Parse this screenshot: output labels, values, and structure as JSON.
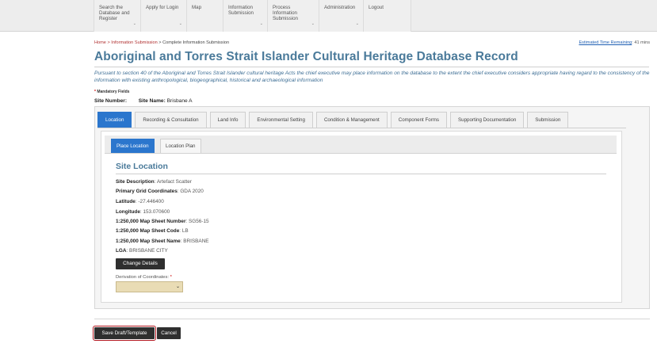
{
  "nav": {
    "items": [
      {
        "line1": "Search the",
        "line2": "Database and",
        "line3": "Register",
        "chevron": "⌄"
      },
      {
        "line1": "Apply for Login",
        "line2": "",
        "line3": "",
        "chevron": "⌄"
      },
      {
        "line1": "Map",
        "line2": "",
        "line3": "",
        "chevron": ""
      },
      {
        "line1": "Information",
        "line2": "Submission",
        "line3": "",
        "chevron": "⌄"
      },
      {
        "line1": "Process",
        "line2": "Information",
        "line3": "Submission",
        "chevron": "⌄"
      },
      {
        "line1": "Administration",
        "line2": "",
        "line3": "",
        "chevron": "⌄"
      },
      {
        "line1": "Logout",
        "line2": "",
        "line3": "",
        "chevron": ""
      }
    ]
  },
  "breadcrumb": {
    "home": "Home",
    "sep1": " > ",
    "info": "Information Submission",
    "sep2": " > ",
    "current": "Complete Information Submission"
  },
  "estimate": {
    "label": "Estimated Time Remaining",
    "value": ": 41 mins"
  },
  "page_title": "Aboriginal and Torres Strait Islander Cultural Heritage Database Record",
  "intro": "Pursuant to section 40 of the Aboriginal and Torres Strait Islander cultural heritage Acts the chief executive may place information on the database to the extent the chief executive considers appropriate having regard to the consistency of the information with existing anthropological, biogeographical, historical and archaeological information",
  "mandatory": {
    "star": "*",
    "label": " Mandatory Fields"
  },
  "site": {
    "number_label": "Site Number:",
    "number_value": "",
    "name_label": "Site Name:",
    "name_value": "Brisbane A"
  },
  "tabs": [
    {
      "label": "Location",
      "active": true
    },
    {
      "label": "Recording & Consultation",
      "active": false
    },
    {
      "label": "Land Info",
      "active": false
    },
    {
      "label": "Environmental Setting",
      "active": false
    },
    {
      "label": "Condition & Management",
      "active": false
    },
    {
      "label": "Component Forms",
      "active": false
    },
    {
      "label": "Supporting Documentation",
      "active": false
    },
    {
      "label": "Submission",
      "active": false
    }
  ],
  "subtabs": {
    "place": "Place Location",
    "plan": "Location Plan"
  },
  "section_title": "Site Location",
  "fields": {
    "site_description": {
      "label": "Site Description",
      "value": ": Artefact Scatter"
    },
    "grid_coordinates": {
      "label": "Primary Grid Coordinates",
      "value": ": GDA 2020"
    },
    "latitude": {
      "label": "Latitude",
      "value": ": -27.446400"
    },
    "longitude": {
      "label": "Longitude",
      "value": ": 153.070600"
    },
    "map_sheet_number": {
      "label": "1:250,000 Map Sheet Number",
      "value": ": SG56-15"
    },
    "map_sheet_code": {
      "label": "1:250,000 Map Sheet Code",
      "value": ": LB"
    },
    "map_sheet_name": {
      "label": "1:250,000 Map Sheet Name",
      "value": ": BRISBANE"
    },
    "lga": {
      "label": "LGA",
      "value": ": BRISBANE CITY"
    }
  },
  "change_details": "Change Details",
  "derivation": {
    "label": "Derivation of Coordinates: ",
    "star": "*",
    "selected": ""
  },
  "buttons": {
    "save": "Save Draft/Template",
    "cancel": "Cancel"
  }
}
